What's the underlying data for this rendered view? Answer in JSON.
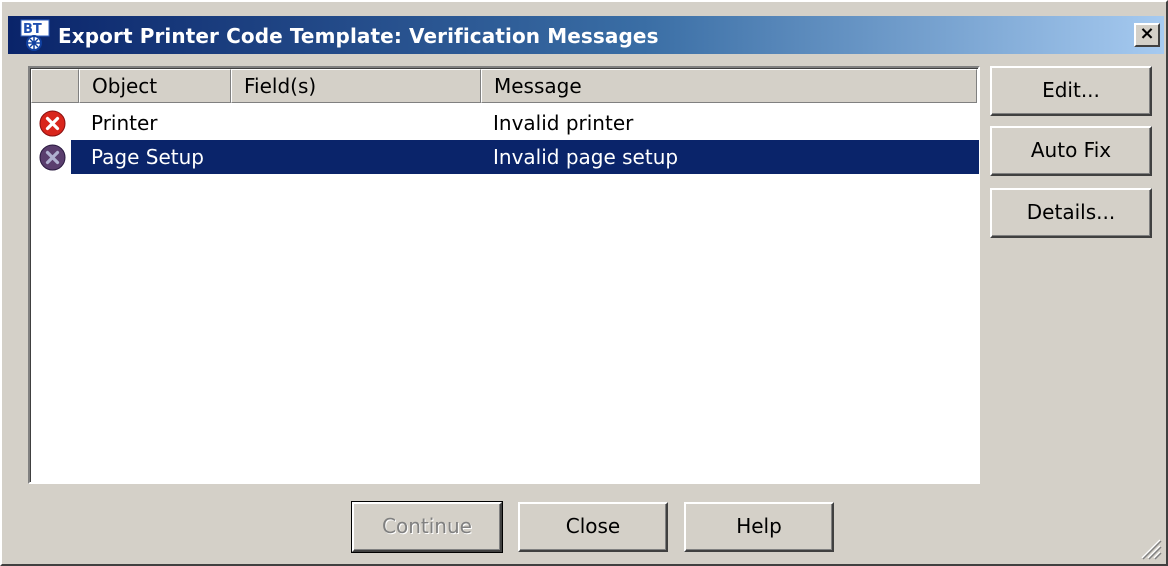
{
  "window": {
    "title": "Export Printer Code Template: Verification Messages",
    "close_glyph": "×",
    "app_icon": "bartender-app-icon"
  },
  "listview": {
    "columns": [
      {
        "label": ""
      },
      {
        "label": "Object"
      },
      {
        "label": "Field(s)"
      },
      {
        "label": "Message"
      }
    ],
    "rows": [
      {
        "icon": "error-icon",
        "object": "Printer",
        "fields": "",
        "message": "Invalid printer",
        "selected": false
      },
      {
        "icon": "error-icon",
        "object": "Page Setup",
        "fields": "",
        "message": "Invalid page setup",
        "selected": true
      }
    ]
  },
  "side_buttons": {
    "edit": "Edit...",
    "auto_fix": "Auto Fix",
    "details": "Details..."
  },
  "bottom_buttons": {
    "continue": "Continue",
    "close": "Close",
    "help": "Help"
  },
  "colors": {
    "selection": "#0a246a",
    "error_red": "#d9261c",
    "face": "#d4d0c8"
  }
}
